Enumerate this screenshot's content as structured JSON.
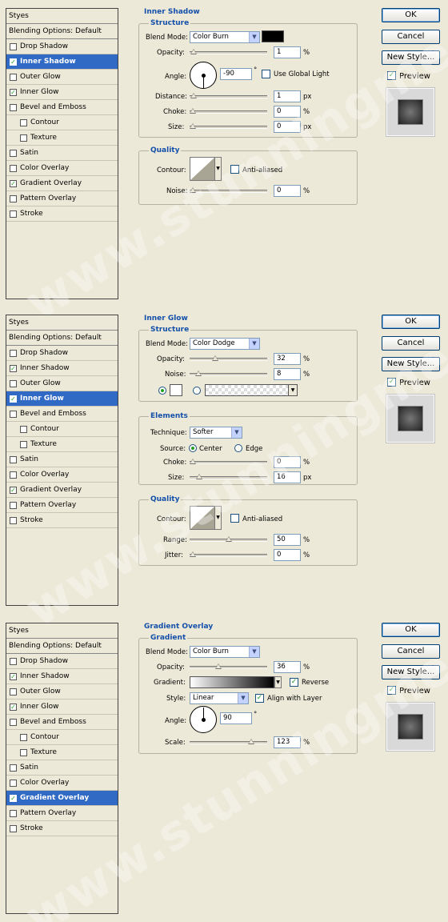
{
  "watermark": "www.stunningmesh.com",
  "buttons": {
    "ok": "OK",
    "cancel": "Cancel",
    "new_style": "New Style...",
    "preview": "Preview"
  },
  "style_list": {
    "header": "Styes",
    "items": [
      "Blending Options: Default",
      "Drop Shadow",
      "Inner Shadow",
      "Outer Glow",
      "Inner Glow",
      "Bevel and Emboss",
      "Contour",
      "Texture",
      "Satin",
      "Color Overlay",
      "Gradient Overlay",
      "Pattern Overlay",
      "Stroke"
    ]
  },
  "panel1": {
    "title": "Inner Shadow",
    "structure": "Structure",
    "blend_mode_label": "Blend Mode:",
    "blend_mode": "Color Burn",
    "opacity_label": "Opacity:",
    "opacity": "1",
    "angle_label": "Angle:",
    "angle": "-90",
    "use_global": "Use Global Light",
    "distance_label": "Distance:",
    "distance": "1",
    "choke_label": "Choke:",
    "choke": "0",
    "size_label": "Size:",
    "size": "0",
    "quality": "Quality",
    "contour_label": "Contour:",
    "anti_aliased": "Anti-aliased",
    "noise_label": "Noise:",
    "noise": "0",
    "pct": "%",
    "px": "px",
    "deg": "°"
  },
  "panel2": {
    "title": "Inner Glow",
    "structure": "Structure",
    "blend_mode_label": "Blend Mode:",
    "blend_mode": "Color Dodge",
    "opacity_label": "Opacity:",
    "opacity": "32",
    "noise_label": "Noise:",
    "noise": "8",
    "elements": "Elements",
    "technique_label": "Technique:",
    "technique": "Softer",
    "source_label": "Source:",
    "center": "Center",
    "edge": "Edge",
    "choke_label": "Choke:",
    "choke": "0",
    "size_label": "Size:",
    "size": "16",
    "quality": "Quality",
    "contour_label": "Contour:",
    "anti_aliased": "Anti-aliased",
    "range_label": "Range:",
    "range": "50",
    "jitter_label": "Jitter:",
    "jitter": "0",
    "pct": "%",
    "px": "px"
  },
  "panel3": {
    "title": "Gradient Overlay",
    "gradient_group": "Gradient",
    "blend_mode_label": "Blend Mode:",
    "blend_mode": "Color Burn",
    "opacity_label": "Opacity:",
    "opacity": "36",
    "gradient_label": "Gradient:",
    "reverse": "Reverse",
    "style_label": "Style:",
    "style": "Linear",
    "align": "Align with Layer",
    "angle_label": "Angle:",
    "angle": "90",
    "scale_label": "Scale:",
    "scale": "123",
    "pct": "%",
    "deg": "°"
  },
  "sliders": {
    "p1_opacity": 0.01,
    "p1_distance": 0.01,
    "p1_choke": 0,
    "p1_size": 0,
    "p1_noise": 0,
    "p2_opacity": 0.32,
    "p2_noise": 0.08,
    "p2_choke": 0,
    "p2_size": 0.09,
    "p2_range": 0.5,
    "p2_jitter": 0,
    "p3_opacity": 0.36,
    "p3_scale": 0.82
  },
  "colors": {
    "accent": "#316ac5",
    "title_blue": "#1450aa",
    "check_green": "#21a121"
  }
}
